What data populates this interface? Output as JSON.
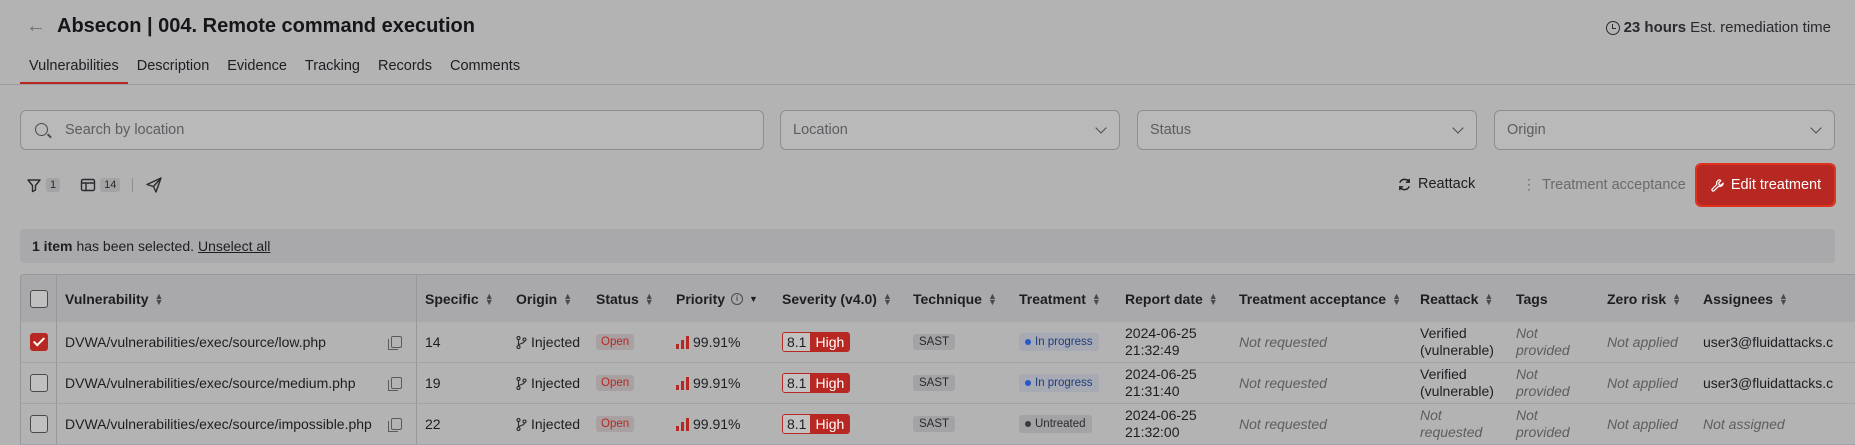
{
  "header": {
    "title": "Absecon | 004. Remote command execution",
    "remediation_hours": "23 hours",
    "remediation_label": "Est. remediation time"
  },
  "tabs": [
    {
      "label": "Vulnerabilities",
      "active": true
    },
    {
      "label": "Description"
    },
    {
      "label": "Evidence"
    },
    {
      "label": "Tracking"
    },
    {
      "label": "Records"
    },
    {
      "label": "Comments"
    }
  ],
  "filters": {
    "search_placeholder": "Search by location",
    "location": "Location",
    "status": "Status",
    "origin": "Origin"
  },
  "toolbar": {
    "filter_count": "1",
    "columns_count": "14",
    "reattack": "Reattack",
    "treatment_acceptance": "Treatment acceptance",
    "edit_treatment": "Edit treatment"
  },
  "selection": {
    "count": "1 item",
    "text": "has been selected.",
    "unselect": "Unselect all"
  },
  "columns": [
    "Vulnerability",
    "Specific",
    "Origin",
    "Status",
    "Priority",
    "Severity (v4.0)",
    "Technique",
    "Treatment",
    "Report date",
    "Treatment acceptance",
    "Reattack",
    "Tags",
    "Zero risk",
    "Assignees"
  ],
  "rows": [
    {
      "checked": true,
      "vulnerability": "DVWA/vulnerabilities/exec/source/low.php",
      "specific": "14",
      "origin": "Injected",
      "status": "Open",
      "priority": "99.91%",
      "severity_score": "8.1",
      "severity_label": "High",
      "technique": "SAST",
      "treatment": "In progress",
      "report_date_1": "2024-06-25",
      "report_date_2": "21:32:49",
      "treatment_acceptance": "Not requested",
      "reattack_1": "Verified",
      "reattack_2": "(vulnerable)",
      "tags_1": "Not",
      "tags_2": "provided",
      "zero_risk": "Not applied",
      "assignees": "user3@fluidattacks.c"
    },
    {
      "checked": false,
      "vulnerability": "DVWA/vulnerabilities/exec/source/medium.php",
      "specific": "19",
      "origin": "Injected",
      "status": "Open",
      "priority": "99.91%",
      "severity_score": "8.1",
      "severity_label": "High",
      "technique": "SAST",
      "treatment": "In progress",
      "report_date_1": "2024-06-25",
      "report_date_2": "21:31:40",
      "treatment_acceptance": "Not requested",
      "reattack_1": "Verified",
      "reattack_2": "(vulnerable)",
      "tags_1": "Not",
      "tags_2": "provided",
      "zero_risk": "Not applied",
      "assignees": "user3@fluidattacks.c"
    },
    {
      "checked": false,
      "vulnerability": "DVWA/vulnerabilities/exec/source/impossible.php",
      "specific": "22",
      "origin": "Injected",
      "status": "Open",
      "priority": "99.91%",
      "severity_score": "8.1",
      "severity_label": "High",
      "technique": "SAST",
      "treatment": "Untreated",
      "report_date_1": "2024-06-25",
      "report_date_2": "21:32:00",
      "treatment_acceptance": "Not requested",
      "reattack_1": "Not",
      "reattack_2": "requested",
      "tags_1": "Not",
      "tags_2": "provided",
      "zero_risk": "Not applied",
      "assignees": "Not assigned"
    }
  ],
  "colors": {
    "accent": "#b82823",
    "overlay": "#b3b3b4"
  }
}
